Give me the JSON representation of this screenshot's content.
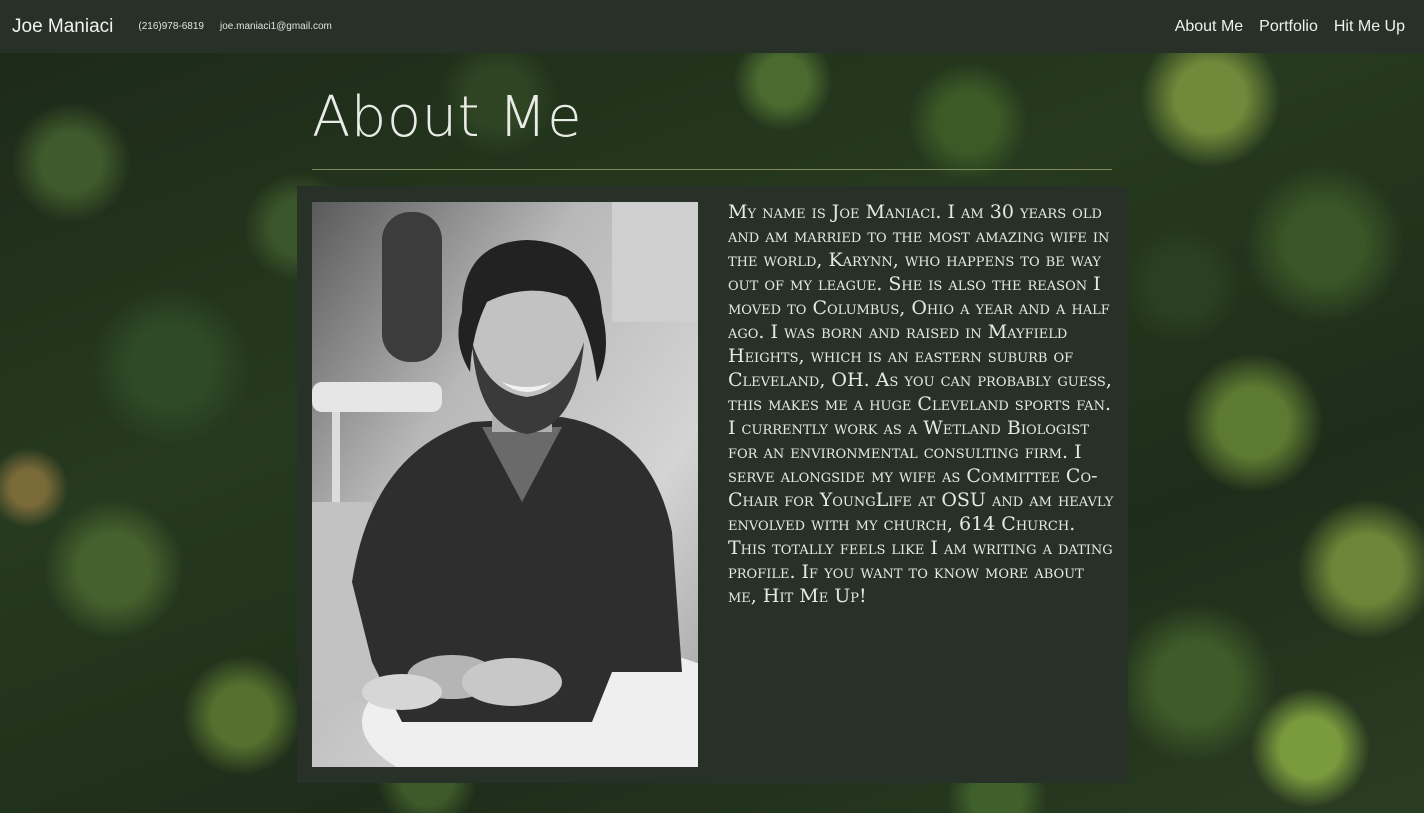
{
  "nav": {
    "brand": "Joe Maniaci",
    "phone": "(216)978-6819",
    "email": "joe.maniaci1@gmail.com",
    "links": [
      "About Me",
      "Portfolio",
      "Hit Me Up"
    ]
  },
  "main": {
    "heading": "About Me",
    "bio": "My name is Joe Maniaci. I am 30 years old and am married to the most amazing wife in the world, Karynn, who happens to be way out of my league. She is also the reason I moved to Columbus, Ohio a year and a half ago. I was born and raised in Mayfield Heights, which is an eastern suburb of Cleveland, OH. As you can probably guess, this makes me a huge Cleveland sports fan. I currently work as a Wetland Biologist for an environmental consulting firm. I serve alongside my wife as Committee Co-Chair for YoungLife at OSU and am heavly envolved with my church, 614 Church. This totally feels like I am writing a dating profile. If you want to know more about me, Hit Me Up!"
  },
  "colors": {
    "navbar_bg": "#283127",
    "card_bg": "#283127",
    "text": "#e6e9e3"
  }
}
